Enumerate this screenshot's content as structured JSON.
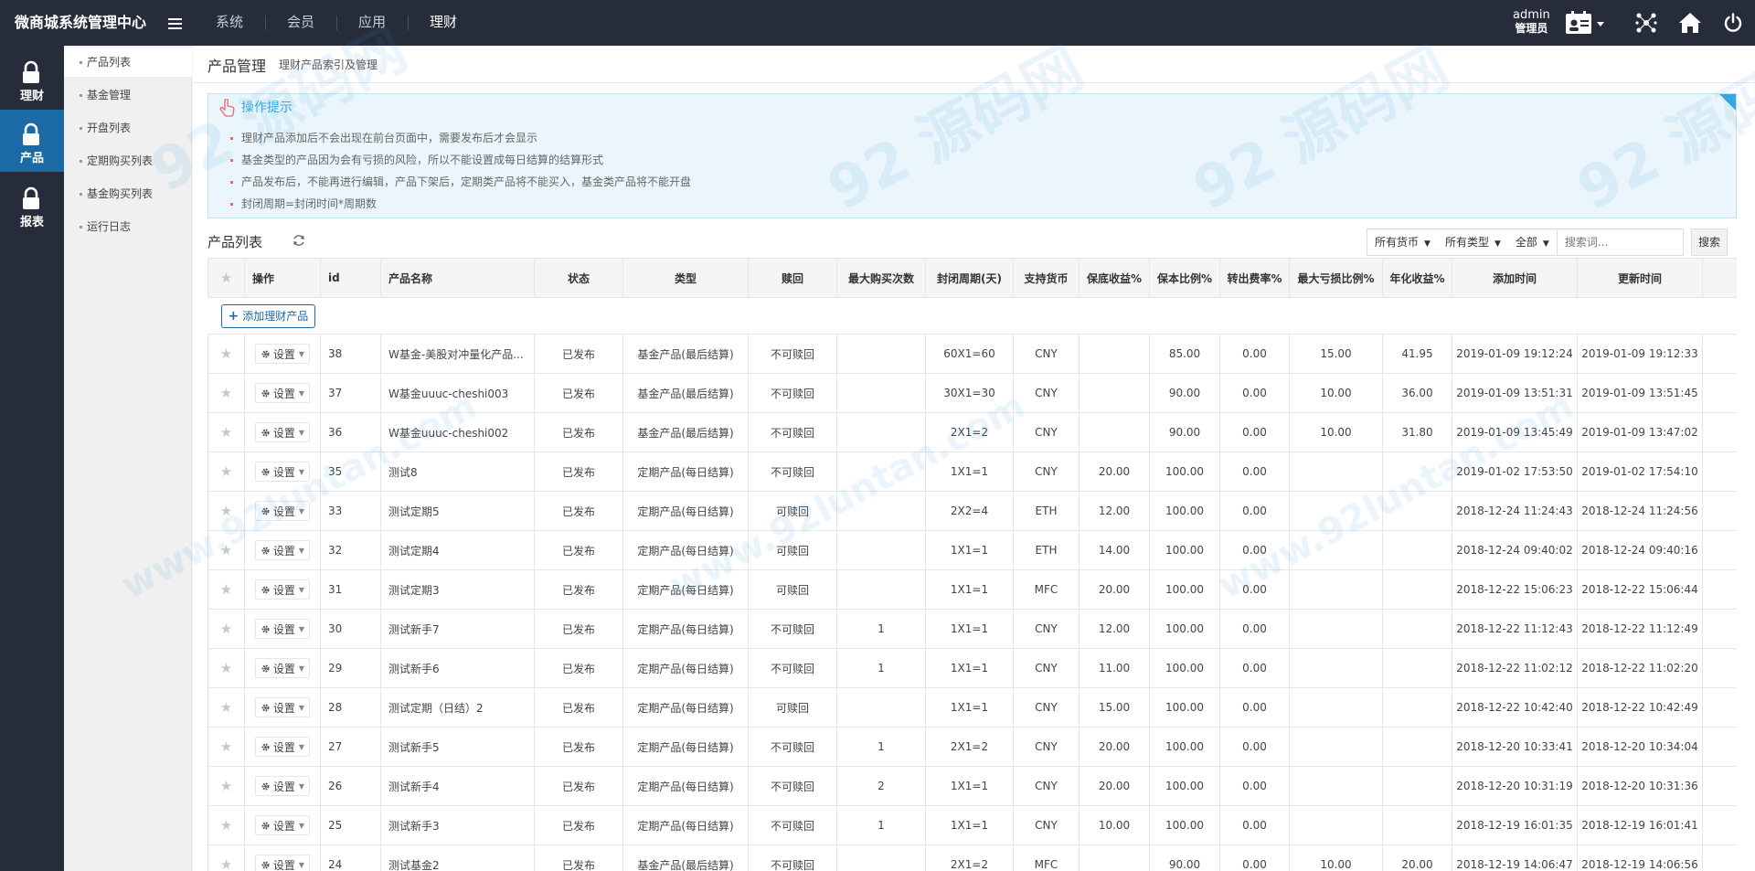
{
  "header": {
    "brand": "微商城系统管理中心",
    "nav": [
      "系统",
      "会员",
      "应用",
      "理财"
    ],
    "active_nav": 3,
    "user_name": "admin",
    "user_role": "管理员"
  },
  "iconbar": {
    "items": [
      {
        "label": "理财",
        "icon": "lock-icon"
      },
      {
        "label": "产品",
        "icon": "lock-icon"
      },
      {
        "label": "报表",
        "icon": "lock-icon"
      }
    ],
    "active": 1
  },
  "submenu": {
    "items": [
      "产品列表",
      "基金管理",
      "开盘列表",
      "定期购买列表",
      "基金购买列表",
      "运行日志"
    ],
    "active": 0
  },
  "page": {
    "title": "产品管理",
    "subtitle": "理财产品索引及管理"
  },
  "tips": {
    "title": "操作提示",
    "items": [
      "理财产品添加后不会出现在前台页面中，需要发布后才会显示",
      "基金类型的产品因为会有亏损的风险，所以不能设置成每日结算的结算形式",
      "产品发布后，不能再进行编辑，产品下架后，定期类产品将不能买入，基金类产品将不能开盘",
      "封闭周期=封闭时间*周期数"
    ]
  },
  "list": {
    "title": "产品列表",
    "filters": [
      "所有货币",
      "所有类型",
      "全部"
    ],
    "search_placeholder": "搜索词...",
    "search_label": "搜索",
    "add_label": "添加理财产品",
    "settings_label": "设置"
  },
  "table": {
    "headers": [
      "操作",
      "id",
      "产品名称",
      "状态",
      "类型",
      "赎回",
      "最大购买次数",
      "封闭周期(天)",
      "支持货币",
      "保底收益%",
      "保本比例%",
      "转出费率%",
      "最大亏损比例%",
      "年化收益%",
      "添加时间",
      "更新时间"
    ],
    "rows": [
      [
        "38",
        "W基金-美股对冲量化产品...",
        "已发布",
        "基金产品(最后结算)",
        "不可赎回",
        "",
        "60X1=60",
        "CNY",
        "",
        "85.00",
        "0.00",
        "15.00",
        "41.95",
        "2019-01-09 19:12:24",
        "2019-01-09 19:12:33"
      ],
      [
        "37",
        "W基金uuuc-cheshi003",
        "已发布",
        "基金产品(最后结算)",
        "不可赎回",
        "",
        "30X1=30",
        "CNY",
        "",
        "90.00",
        "0.00",
        "10.00",
        "36.00",
        "2019-01-09 13:51:31",
        "2019-01-09 13:51:45"
      ],
      [
        "36",
        "W基金uuuc-cheshi002",
        "已发布",
        "基金产品(最后结算)",
        "不可赎回",
        "",
        "2X1=2",
        "CNY",
        "",
        "90.00",
        "0.00",
        "10.00",
        "31.80",
        "2019-01-09 13:45:49",
        "2019-01-09 13:47:02"
      ],
      [
        "35",
        "测试8",
        "已发布",
        "定期产品(每日结算)",
        "不可赎回",
        "",
        "1X1=1",
        "CNY",
        "20.00",
        "100.00",
        "0.00",
        "",
        "",
        "2019-01-02 17:53:50",
        "2019-01-02 17:54:10"
      ],
      [
        "33",
        "测试定期5",
        "已发布",
        "定期产品(每日结算)",
        "可赎回",
        "",
        "2X2=4",
        "ETH",
        "12.00",
        "100.00",
        "0.00",
        "",
        "",
        "2018-12-24 11:24:43",
        "2018-12-24 11:24:56"
      ],
      [
        "32",
        "测试定期4",
        "已发布",
        "定期产品(每日结算)",
        "可赎回",
        "",
        "1X1=1",
        "ETH",
        "14.00",
        "100.00",
        "0.00",
        "",
        "",
        "2018-12-24 09:40:02",
        "2018-12-24 09:40:16"
      ],
      [
        "31",
        "测试定期3",
        "已发布",
        "定期产品(每日结算)",
        "可赎回",
        "",
        "1X1=1",
        "MFC",
        "20.00",
        "100.00",
        "0.00",
        "",
        "",
        "2018-12-22 15:06:23",
        "2018-12-22 15:06:44"
      ],
      [
        "30",
        "测试新手7",
        "已发布",
        "定期产品(每日结算)",
        "不可赎回",
        "1",
        "1X1=1",
        "CNY",
        "12.00",
        "100.00",
        "0.00",
        "",
        "",
        "2018-12-22 11:12:43",
        "2018-12-22 11:12:49"
      ],
      [
        "29",
        "测试新手6",
        "已发布",
        "定期产品(每日结算)",
        "不可赎回",
        "1",
        "1X1=1",
        "CNY",
        "11.00",
        "100.00",
        "0.00",
        "",
        "",
        "2018-12-22 11:02:12",
        "2018-12-22 11:02:20"
      ],
      [
        "28",
        "测试定期（日结）2",
        "已发布",
        "定期产品(每日结算)",
        "可赎回",
        "",
        "1X1=1",
        "CNY",
        "15.00",
        "100.00",
        "0.00",
        "",
        "",
        "2018-12-22 10:42:40",
        "2018-12-22 10:42:49"
      ],
      [
        "27",
        "测试新手5",
        "已发布",
        "定期产品(每日结算)",
        "不可赎回",
        "1",
        "2X1=2",
        "CNY",
        "20.00",
        "100.00",
        "0.00",
        "",
        "",
        "2018-12-20 10:33:41",
        "2018-12-20 10:34:04"
      ],
      [
        "26",
        "测试新手4",
        "已发布",
        "定期产品(每日结算)",
        "不可赎回",
        "2",
        "1X1=1",
        "CNY",
        "20.00",
        "100.00",
        "0.00",
        "",
        "",
        "2018-12-20 10:31:19",
        "2018-12-20 10:31:36"
      ],
      [
        "25",
        "测试新手3",
        "已发布",
        "定期产品(每日结算)",
        "不可赎回",
        "1",
        "1X1=1",
        "CNY",
        "10.00",
        "100.00",
        "0.00",
        "",
        "",
        "2018-12-19 16:01:35",
        "2018-12-19 16:01:41"
      ],
      [
        "24",
        "测试基金2",
        "已发布",
        "基金产品(最后结算)",
        "不可赎回",
        "",
        "2X1=2",
        "MFC",
        "",
        "90.00",
        "0.00",
        "10.00",
        "20.00",
        "2018-12-19 14:06:47",
        "2018-12-19 14:06:56"
      ]
    ]
  },
  "watermark": {
    "text1": "92 源码网",
    "text2": "www.92luntan.com"
  },
  "colors": {
    "topbar": "#262c3a",
    "accent": "#1b6aa5",
    "tips_bg": "#eaf6fb",
    "tips_title": "#36a9e1"
  }
}
